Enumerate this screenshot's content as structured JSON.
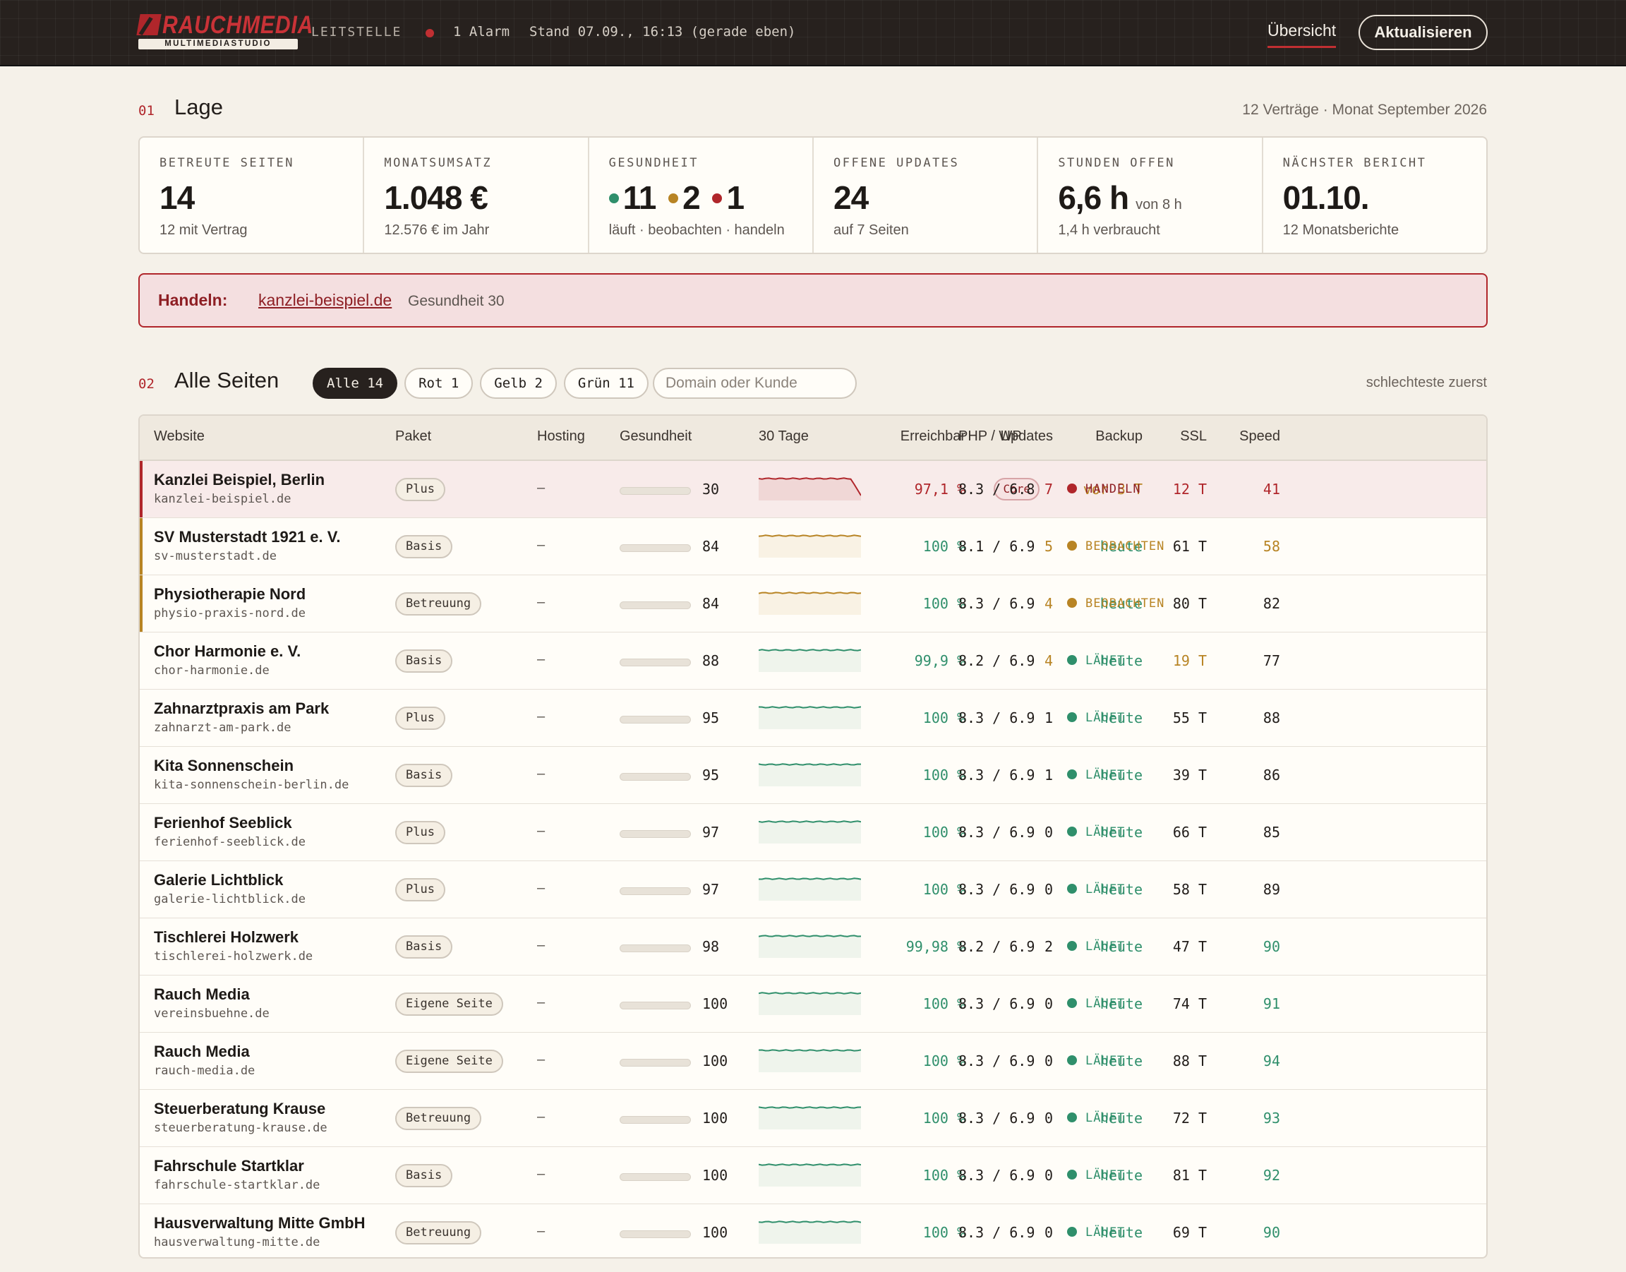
{
  "colors": {
    "red": "#b0262b",
    "yellow": "#b88424",
    "green": "#2f8f6b",
    "dark": "#27211e",
    "cream": "#f5f1e9"
  },
  "topbar": {
    "logo_word": "RAUCHMEDIA",
    "logo_sub": "MULTIMEDIASTUDIO",
    "section_label": "LEITSTELLE",
    "alarm_text": "1 Alarm",
    "stand_text": "Stand 07.09., 16:13 (gerade eben)",
    "nav_overview": "Übersicht",
    "refresh_button": "Aktualisieren"
  },
  "lage": {
    "number": "01",
    "title": "Lage",
    "meta": "12 Verträge · Monat September 2026",
    "kpis": [
      {
        "label": "BETREUTE SEITEN",
        "value": "14",
        "sub": "12 mit Vertrag"
      },
      {
        "label": "MONATSUMSATZ",
        "value": "1.048 €",
        "sub": "12.576 € im Jahr"
      },
      {
        "label": "GESUNDHEIT",
        "green": "11",
        "yellow": "2",
        "red": "1",
        "sub": "läuft · beobachten · handeln"
      },
      {
        "label": "OFFENE UPDATES",
        "value": "24",
        "sub": "auf 7 Seiten"
      },
      {
        "label": "STUNDEN OFFEN",
        "value": "6,6 h",
        "value_suffix": "von 8 h",
        "sub": "1,4 h verbraucht"
      },
      {
        "label": "NÄCHSTER BERICHT",
        "value": "01.10.",
        "sub": "12 Monatsberichte"
      }
    ]
  },
  "alert": {
    "label": "Handeln:",
    "link": "kanzlei-beispiel.de",
    "note": "Gesundheit 30"
  },
  "sites": {
    "number": "02",
    "title": "Alle Seiten",
    "filters": [
      "Alle 14",
      "Rot 1",
      "Gelb 2",
      "Grün 11"
    ],
    "search_placeholder": "Domain oder Kunde",
    "sort_label": "schlechteste zuerst",
    "columns": [
      "Website",
      "Paket",
      "Hosting",
      "Gesundheit",
      "30 Tage",
      "Erreichbar",
      "Updates",
      "Backup",
      "SSL",
      "Speed",
      "PHP / WP"
    ],
    "rows": [
      {
        "name": "Kanzlei Beispiel, Berlin",
        "domain": "kanzlei-beispiel.de",
        "package": "Plus",
        "hosting": "–",
        "health": 30,
        "trend": "drop",
        "reach": "97,1 %",
        "updates": "7",
        "core": "Core",
        "backup": "vor 3 T",
        "ssl": "12 T",
        "speed": "41",
        "php": "8.3 / 6.8",
        "status": "HANDELN",
        "severity": "red",
        "ssl_level": "red",
        "speed_level": "red",
        "upd_level": "red",
        "backup_level": "yellow",
        "reach_level": "red"
      },
      {
        "name": "SV Musterstadt 1921 e. V.",
        "domain": "sv-musterstadt.de",
        "package": "Basis",
        "hosting": "–",
        "health": 84,
        "trend": "flat",
        "reach": "100 %",
        "updates": "5",
        "backup": "heute",
        "ssl": "61 T",
        "speed": "58",
        "php": "8.1 / 6.9",
        "status": "BEOBACHTEN",
        "severity": "yellow",
        "ssl_level": "neutral",
        "speed_level": "yellow",
        "upd_level": "yellow",
        "backup_level": "green",
        "reach_level": "green"
      },
      {
        "name": "Physiotherapie Nord",
        "domain": "physio-praxis-nord.de",
        "package": "Betreuung",
        "hosting": "–",
        "health": 84,
        "trend": "flat",
        "reach": "100 %",
        "updates": "4",
        "backup": "heute",
        "ssl": "80 T",
        "speed": "82",
        "php": "8.3 / 6.9",
        "status": "BEOBACHTEN",
        "severity": "yellow",
        "ssl_level": "neutral",
        "speed_level": "neutral",
        "upd_level": "yellow",
        "backup_level": "green",
        "reach_level": "green"
      },
      {
        "name": "Chor Harmonie e. V.",
        "domain": "chor-harmonie.de",
        "package": "Basis",
        "hosting": "–",
        "health": 88,
        "trend": "flat",
        "reach": "99,9 %",
        "updates": "4",
        "backup": "heute",
        "ssl": "19 T",
        "speed": "77",
        "php": "8.2 / 6.9",
        "status": "LÄUFT",
        "severity": "green",
        "ssl_level": "yellow",
        "speed_level": "neutral",
        "upd_level": "yellow",
        "backup_level": "green",
        "reach_level": "green"
      },
      {
        "name": "Zahnarztpraxis am Park",
        "domain": "zahnarzt-am-park.de",
        "package": "Plus",
        "hosting": "–",
        "health": 95,
        "trend": "flat",
        "reach": "100 %",
        "updates": "1",
        "backup": "heute",
        "ssl": "55 T",
        "speed": "88",
        "php": "8.3 / 6.9",
        "status": "LÄUFT",
        "severity": "green",
        "ssl_level": "neutral",
        "speed_level": "neutral",
        "upd_level": "neutral",
        "backup_level": "green",
        "reach_level": "green"
      },
      {
        "name": "Kita Sonnenschein",
        "domain": "kita-sonnenschein-berlin.de",
        "package": "Basis",
        "hosting": "–",
        "health": 95,
        "trend": "flat",
        "reach": "100 %",
        "updates": "1",
        "backup": "heute",
        "ssl": "39 T",
        "speed": "86",
        "php": "8.3 / 6.9",
        "status": "LÄUFT",
        "severity": "green",
        "ssl_level": "neutral",
        "speed_level": "neutral",
        "upd_level": "neutral",
        "backup_level": "green",
        "reach_level": "green"
      },
      {
        "name": "Ferienhof Seeblick",
        "domain": "ferienhof-seeblick.de",
        "package": "Plus",
        "hosting": "–",
        "health": 97,
        "trend": "flat",
        "reach": "100 %",
        "updates": "0",
        "backup": "heute",
        "ssl": "66 T",
        "speed": "85",
        "php": "8.3 / 6.9",
        "status": "LÄUFT",
        "severity": "green",
        "ssl_level": "neutral",
        "speed_level": "neutral",
        "upd_level": "neutral",
        "backup_level": "green",
        "reach_level": "green"
      },
      {
        "name": "Galerie Lichtblick",
        "domain": "galerie-lichtblick.de",
        "package": "Plus",
        "hosting": "–",
        "health": 97,
        "trend": "flat",
        "reach": "100 %",
        "updates": "0",
        "backup": "heute",
        "ssl": "58 T",
        "speed": "89",
        "php": "8.3 / 6.9",
        "status": "LÄUFT",
        "severity": "green",
        "ssl_level": "neutral",
        "speed_level": "neutral",
        "upd_level": "neutral",
        "backup_level": "green",
        "reach_level": "green"
      },
      {
        "name": "Tischlerei Holzwerk",
        "domain": "tischlerei-holzwerk.de",
        "package": "Basis",
        "hosting": "–",
        "health": 98,
        "trend": "flat",
        "reach": "99,98 %",
        "updates": "2",
        "backup": "heute",
        "ssl": "47 T",
        "speed": "90",
        "php": "8.2 / 6.9",
        "status": "LÄUFT",
        "severity": "green",
        "ssl_level": "neutral",
        "speed_level": "green",
        "upd_level": "neutral",
        "backup_level": "green",
        "reach_level": "green"
      },
      {
        "name": "Rauch Media",
        "domain": "vereinsbuehne.de",
        "package": "Eigene Seite",
        "hosting": "–",
        "health": 100,
        "trend": "flat",
        "reach": "100 %",
        "updates": "0",
        "backup": "heute",
        "ssl": "74 T",
        "speed": "91",
        "php": "8.3 / 6.9",
        "status": "LÄUFT",
        "severity": "green",
        "ssl_level": "neutral",
        "speed_level": "green",
        "upd_level": "neutral",
        "backup_level": "green",
        "reach_level": "green"
      },
      {
        "name": "Rauch Media",
        "domain": "rauch-media.de",
        "package": "Eigene Seite",
        "hosting": "–",
        "health": 100,
        "trend": "flat",
        "reach": "100 %",
        "updates": "0",
        "backup": "heute",
        "ssl": "88 T",
        "speed": "94",
        "php": "8.3 / 6.9",
        "status": "LÄUFT",
        "severity": "green",
        "ssl_level": "neutral",
        "speed_level": "green",
        "upd_level": "neutral",
        "backup_level": "green",
        "reach_level": "green"
      },
      {
        "name": "Steuerberatung Krause",
        "domain": "steuerberatung-krause.de",
        "package": "Betreuung",
        "hosting": "–",
        "health": 100,
        "trend": "flat",
        "reach": "100 %",
        "updates": "0",
        "backup": "heute",
        "ssl": "72 T",
        "speed": "93",
        "php": "8.3 / 6.9",
        "status": "LÄUFT",
        "severity": "green",
        "ssl_level": "neutral",
        "speed_level": "green",
        "upd_level": "neutral",
        "backup_level": "green",
        "reach_level": "green"
      },
      {
        "name": "Fahrschule Startklar",
        "domain": "fahrschule-startklar.de",
        "package": "Basis",
        "hosting": "–",
        "health": 100,
        "trend": "flat",
        "reach": "100 %",
        "updates": "0",
        "backup": "heute",
        "ssl": "81 T",
        "speed": "92",
        "php": "8.3 / 6.9",
        "status": "LÄUFT",
        "severity": "green",
        "ssl_level": "neutral",
        "speed_level": "green",
        "upd_level": "neutral",
        "backup_level": "green",
        "reach_level": "green"
      },
      {
        "name": "Hausverwaltung Mitte GmbH",
        "domain": "hausverwaltung-mitte.de",
        "package": "Betreuung",
        "hosting": "–",
        "health": 100,
        "trend": "flat",
        "reach": "100 %",
        "updates": "0",
        "backup": "heute",
        "ssl": "69 T",
        "speed": "90",
        "php": "8.3 / 6.9",
        "status": "LÄUFT",
        "severity": "green",
        "ssl_level": "neutral",
        "speed_level": "green",
        "upd_level": "neutral",
        "backup_level": "green",
        "reach_level": "green"
      }
    ]
  }
}
